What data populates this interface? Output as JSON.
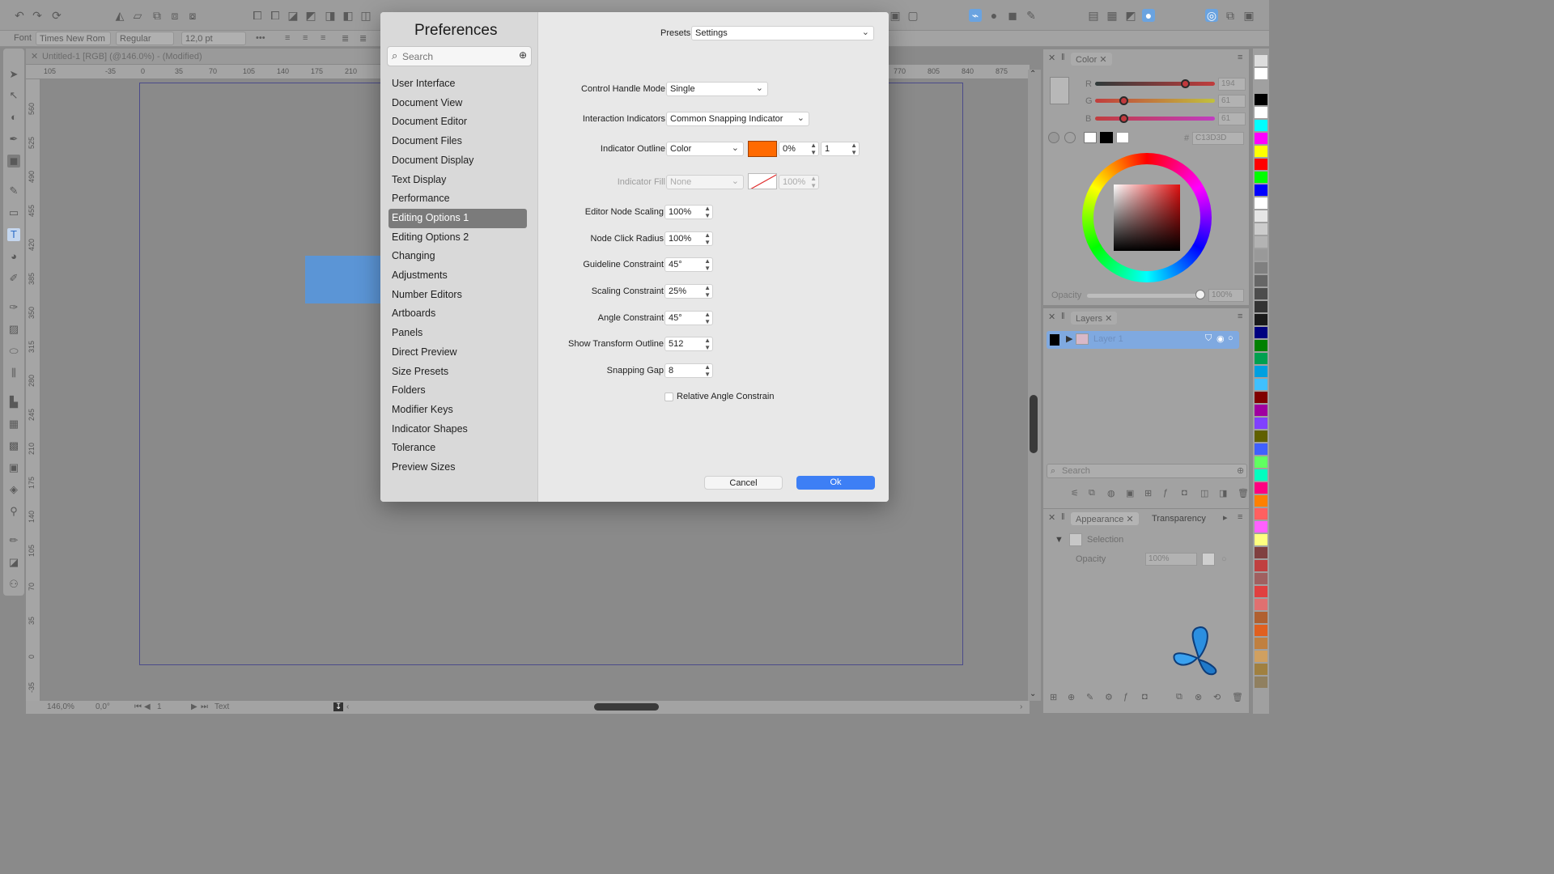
{
  "context_bar": {
    "font_label": "Font",
    "font_family": "Times New Rom",
    "font_style": "Regular",
    "font_size": "12,0 pt"
  },
  "document": {
    "tab_title": "Untitled-1 [RGB] (@146.0%) - (Modified)"
  },
  "rulers": {
    "horizontal": [
      "105",
      "-35",
      "0",
      "35",
      "70",
      "105",
      "140",
      "175",
      "210",
      "770",
      "805",
      "840",
      "875"
    ],
    "vertical": [
      "560",
      "525",
      "490",
      "455",
      "420",
      "385",
      "350",
      "315",
      "280",
      "245",
      "210",
      "175",
      "140",
      "105",
      "70",
      "35",
      "0",
      "-35"
    ]
  },
  "status_bar": {
    "zoom": "146,0%",
    "rotation": "0,0°",
    "page": "1",
    "tool_name": "Text"
  },
  "color_panel": {
    "tab_label": "Color",
    "r_label": "R",
    "g_label": "G",
    "b_label": "B",
    "r_value": "194",
    "g_value": "61",
    "b_value": "61",
    "hex_label": "#",
    "hex_value": "C13D3D",
    "opacity_label": "Opacity",
    "opacity_value": "100%",
    "r_level": 0.76,
    "g_level": 0.24,
    "b_level": 0.24
  },
  "layers_panel": {
    "tab_label": "Layers",
    "layer_name": "Layer 1",
    "search_placeholder": "Search"
  },
  "appearance_panel": {
    "tab_appearance": "Appearance",
    "tab_transparency": "Transparency",
    "selection_label": "Selection",
    "opacity_label": "Opacity",
    "opacity_value": "100%"
  },
  "dialog": {
    "title": "Preferences",
    "search_placeholder": "Search",
    "nav_items": [
      "User Interface",
      "Document View",
      "Document Editor",
      "Document Files",
      "Document Display",
      "Text Display",
      "Performance",
      "Editing Options 1",
      "Editing Options 2",
      "Changing",
      "Adjustments",
      "Number Editors",
      "Artboards",
      "Panels",
      "Direct Preview",
      "Size Presets",
      "Folders",
      "Modifier Keys",
      "Indicator Shapes",
      "Tolerance",
      "Preview Sizes"
    ],
    "selected_nav": "Editing Options 1",
    "presets_label": "Presets",
    "presets_value": "Settings",
    "fields": {
      "control_handle_mode": {
        "label": "Control Handle Mode",
        "value": "Single"
      },
      "interaction_indicators": {
        "label": "Interaction Indicators",
        "value": "Common Snapping Indicator"
      },
      "indicator_outline": {
        "label": "Indicator Outline",
        "value": "Color",
        "color": "#ff6a00",
        "percent": "0%",
        "width": "1"
      },
      "indicator_fill": {
        "label": "Indicator Fill",
        "value": "None",
        "percent": "100%"
      },
      "editor_node_scaling": {
        "label": "Editor Node Scaling",
        "value": "100%"
      },
      "node_click_radius": {
        "label": "Node Click Radius",
        "value": "100%"
      },
      "guideline_constraint": {
        "label": "Guideline Constraint",
        "value": "45°"
      },
      "scaling_constraint": {
        "label": "Scaling Constraint",
        "value": "25%"
      },
      "angle_constraint": {
        "label": "Angle Constraint",
        "value": "45°"
      },
      "show_transform_outline": {
        "label": "Show Transform Outline",
        "value": "512"
      },
      "snapping_gap": {
        "label": "Snapping Gap",
        "value": "8"
      },
      "relative_angle": {
        "label": "Relative Angle Constrain",
        "checked": false
      }
    },
    "cancel_label": "Cancel",
    "ok_label": "Ok",
    "ok_color": "#3d7ff5"
  }
}
